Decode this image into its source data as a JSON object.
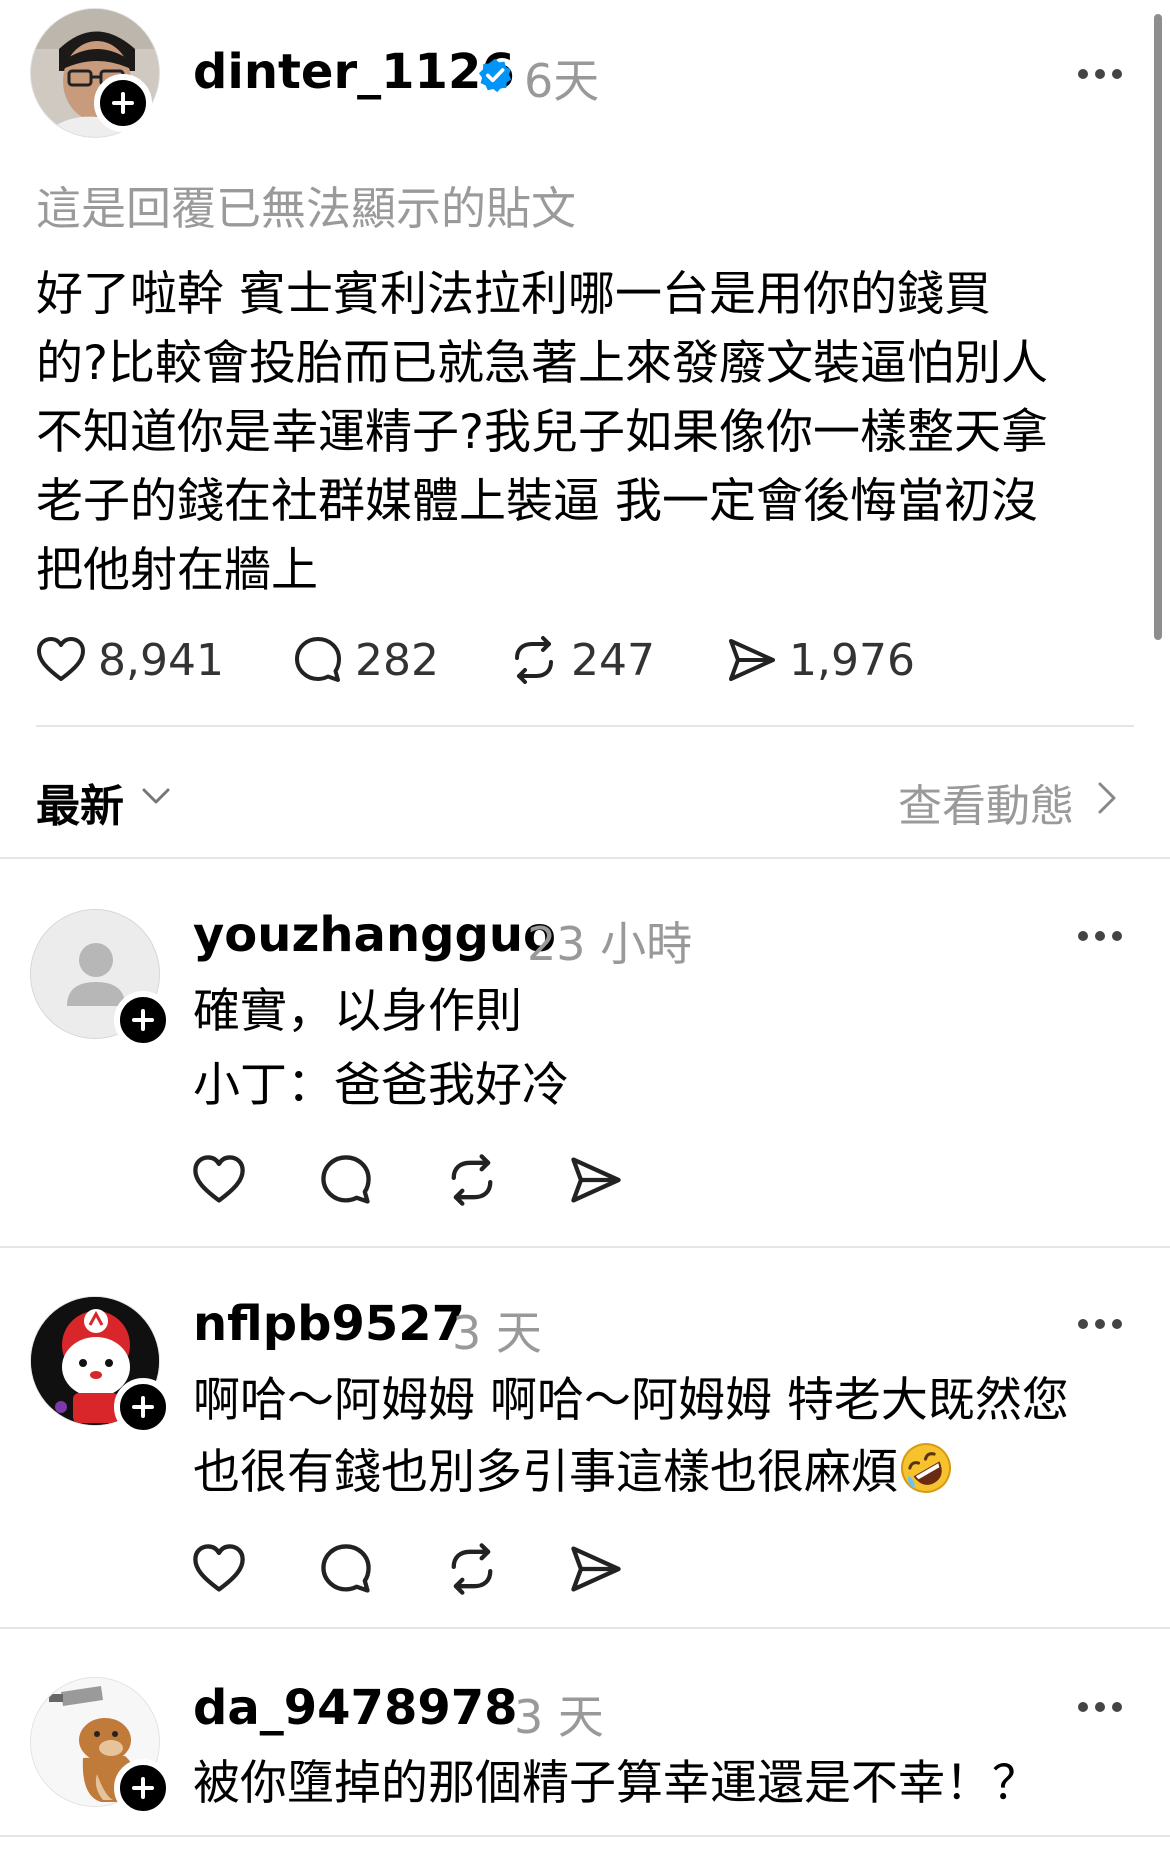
{
  "post": {
    "username": "dinter_1126",
    "time": "6天",
    "reply_note": "這是回覆已無法顯示的貼文",
    "lines": [
      "好了啦幹 賓士賓利法拉利哪一台是用你的錢買",
      "的?比較會投胎而已就急著上來發廢文裝逼怕別人",
      "不知道你是幸運精子?我兒子如果像你一樣整天拿",
      "老子的錢在社群媒體上裝逼 我一定會後悔當初沒",
      "把他射在牆上"
    ],
    "stats": {
      "likes": "8,941",
      "comments": "282",
      "reposts": "247",
      "shares": "1,976"
    }
  },
  "sort": {
    "label": "最新",
    "activity_label": "查看動態"
  },
  "comments": [
    {
      "username": "youzhangguo",
      "time": "23 小時",
      "lines": [
        "確實，以身作則",
        "小丁：爸爸我好冷"
      ]
    },
    {
      "username": "nflpb9527",
      "time": "3 天",
      "lines": [
        "啊哈～阿姆姆 啊哈～阿姆姆 特老大既然您",
        "也很有錢也別多引事這樣也很麻煩"
      ],
      "emoji": "rolling-on-floor-laughing"
    },
    {
      "username": "da_9478978",
      "time": "3 天",
      "lines": [
        "被你墮掉的那個精子算幸運還是不幸！？"
      ]
    }
  ],
  "colors": {
    "verified": "#0095f6",
    "muted_text": "#999999",
    "divider": "#e5e5e5"
  }
}
